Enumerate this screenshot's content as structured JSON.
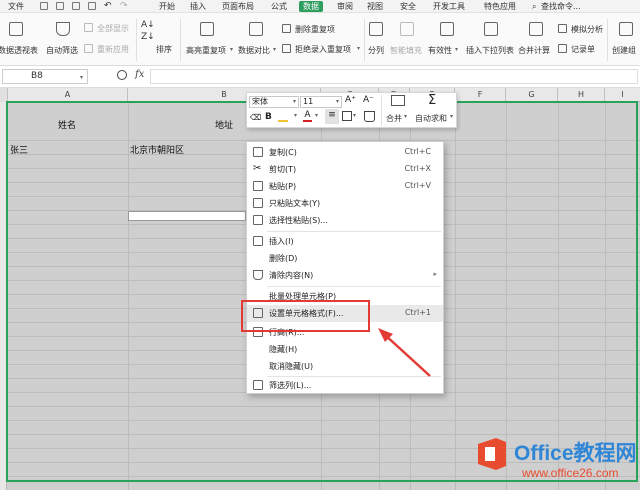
{
  "menubar": {
    "file": "文件",
    "tabs": [
      "开始",
      "插入",
      "页面布局",
      "公式",
      "数据",
      "审阅",
      "视图",
      "安全",
      "开发工具",
      "特色应用"
    ],
    "active_tab": "数据",
    "search": "查找命令..."
  },
  "ribbon": {
    "pivot": "数据透视表",
    "autofilter": "自动筛选",
    "show_all": "全部显示",
    "reapply": "重新应用",
    "sort": "排序",
    "highlight_dup": "高亮重复项",
    "compare": "数据对比",
    "remove_dup": "删除重复项",
    "reject_dup": "拒绝录入重复项",
    "split": "分列",
    "smart_fill": "智能填充",
    "validity": "有效性",
    "dropdown": "插入下拉列表",
    "consolidate": "合并计算",
    "simulate": "模拟分析",
    "record": "记录单",
    "create_group": "创建组"
  },
  "formula_bar": {
    "name_box": "B8",
    "fx": "fx",
    "value": ""
  },
  "columns": [
    "A",
    "B",
    "C",
    "D",
    "E",
    "F",
    "G",
    "H",
    "I"
  ],
  "cells": {
    "a1": "姓名",
    "b1": "地址",
    "a2": "张三",
    "b2": "北京市朝阳区"
  },
  "mini_toolbar": {
    "font": "宋体",
    "size": "11",
    "grow": "A⁺",
    "shrink": "A⁻",
    "bold": "B",
    "merge": "合并",
    "autosum": "自动求和"
  },
  "context_menu": {
    "items": [
      {
        "label": "复制(C)",
        "shortcut": "Ctrl+C",
        "icon": "copy-icon"
      },
      {
        "label": "剪切(T)",
        "shortcut": "Ctrl+X",
        "icon": "cut-icon"
      },
      {
        "label": "粘贴(P)",
        "shortcut": "Ctrl+V",
        "icon": "paste-icon"
      },
      {
        "label": "只粘贴文本(Y)",
        "shortcut": "",
        "icon": "paste-text-icon"
      },
      {
        "label": "选择性粘贴(S)...",
        "shortcut": "",
        "icon": "paste-special-icon"
      },
      {
        "label": "插入(I)",
        "shortcut": "",
        "icon": "insert-icon"
      },
      {
        "label": "删除(D)",
        "shortcut": "",
        "icon": ""
      },
      {
        "label": "清除内容(N)",
        "shortcut": "",
        "icon": "clear-icon"
      },
      {
        "label": "批量处理单元格(P)",
        "shortcut": "",
        "icon": ""
      },
      {
        "label": "设置单元格格式(F)...",
        "shortcut": "Ctrl+1",
        "icon": "format-cells-icon"
      },
      {
        "label": "行高(R)...",
        "shortcut": "",
        "icon": "row-height-icon"
      },
      {
        "label": "隐藏(H)",
        "shortcut": "",
        "icon": ""
      },
      {
        "label": "取消隐藏(U)",
        "shortcut": "",
        "icon": ""
      },
      {
        "label": "筛选列(L)...",
        "shortcut": "",
        "icon": "filter-column-icon"
      }
    ],
    "highlighted_index": 9
  },
  "watermark": {
    "brand": "Office教程网",
    "url": "www.office26.com"
  },
  "colors": {
    "accent": "#2e9e5f",
    "annotation": "#e23b35",
    "brand_blue": "#2f86d6",
    "brand_orange": "#e84b2d"
  }
}
